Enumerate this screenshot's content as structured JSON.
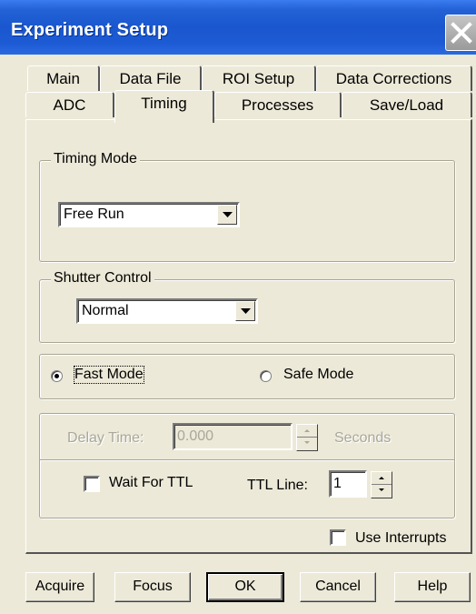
{
  "window": {
    "title": "Experiment Setup"
  },
  "tabs": {
    "back_row": [
      "Main",
      "Data File",
      "ROI Setup",
      "Data Corrections"
    ],
    "front_row": [
      "ADC",
      "Timing",
      "Processes",
      "Save/Load"
    ],
    "active": "Timing"
  },
  "timing_mode": {
    "legend": "Timing Mode",
    "selected": "Free Run"
  },
  "shutter_control": {
    "legend": "Shutter Control",
    "selected": "Normal"
  },
  "mode": {
    "fast_label": "Fast Mode",
    "safe_label": "Safe Mode",
    "fast_checked": true,
    "safe_checked": false
  },
  "delay": {
    "label": "Delay Time:",
    "value": "0.000",
    "unit": "Seconds",
    "enabled": false
  },
  "ttl": {
    "wait_label": "Wait For TTL",
    "wait_checked": false,
    "line_label": "TTL Line:",
    "line_value": "1"
  },
  "interrupts": {
    "label": "Use Interrupts",
    "checked": false
  },
  "buttons": {
    "acquire": "Acquire",
    "focus": "Focus",
    "ok": "OK",
    "cancel": "Cancel",
    "help": "Help"
  },
  "colors": {
    "titlebar": "#1d5bd4",
    "dialog_face": "#ece9d8",
    "disabled_text": "#a9a79a"
  }
}
